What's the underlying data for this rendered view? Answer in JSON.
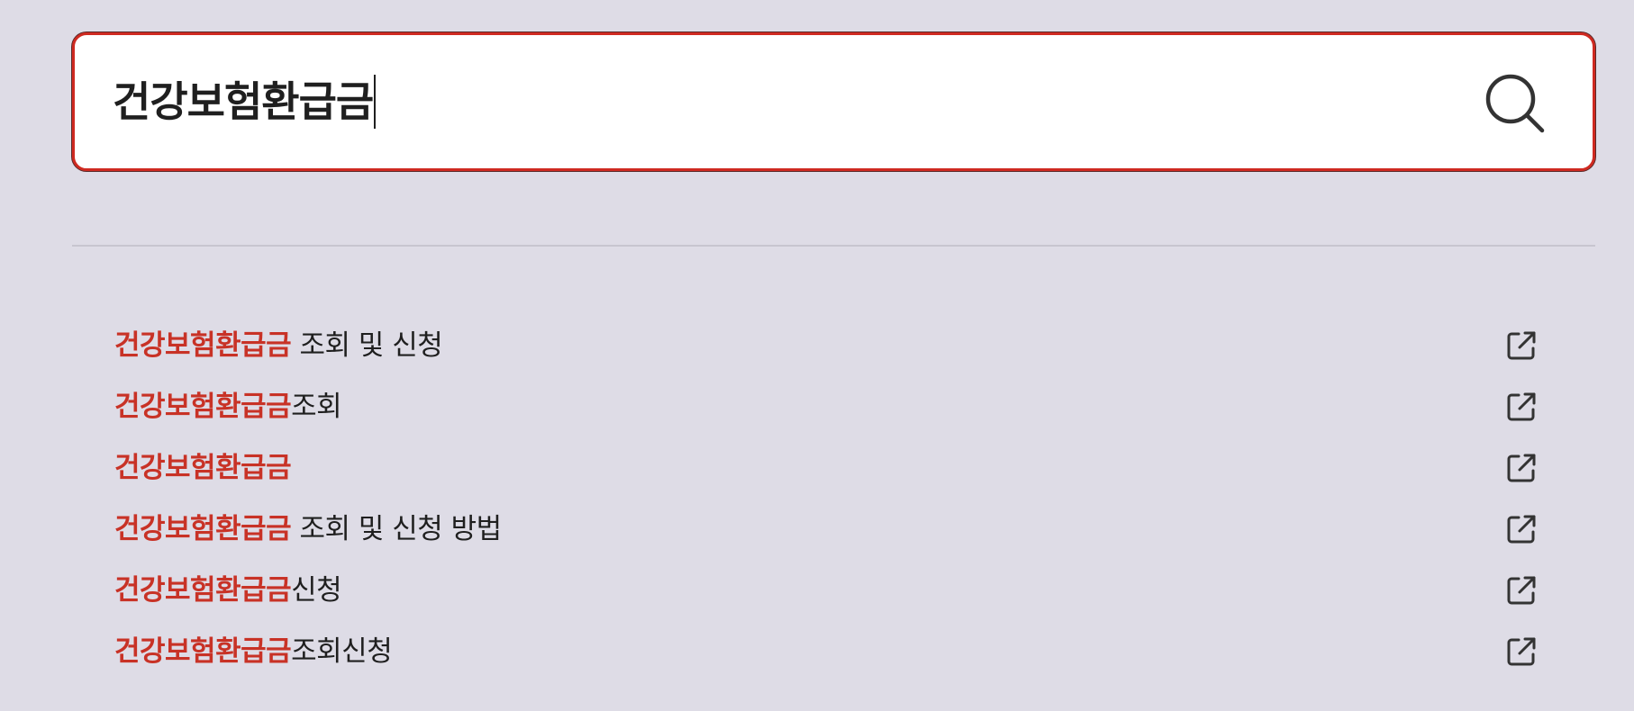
{
  "search": {
    "query": "건강보험환급금",
    "icon": "search-icon"
  },
  "suggestions": [
    {
      "highlight": "건강보험환급금",
      "rest": " 조회 및 신청",
      "icon": "external-link-icon"
    },
    {
      "highlight": "건강보험환급금",
      "rest": "조회",
      "icon": "external-link-icon"
    },
    {
      "highlight": "건강보험환급금",
      "rest": "",
      "icon": "external-link-icon"
    },
    {
      "highlight": "건강보험환급금",
      "rest": " 조회 및 신청 방법",
      "icon": "external-link-icon"
    },
    {
      "highlight": "건강보험환급금",
      "rest": "신청",
      "icon": "external-link-icon"
    },
    {
      "highlight": "건강보험환급금",
      "rest": "조회신청",
      "icon": "external-link-icon"
    }
  ],
  "colors": {
    "background": "#dedce6",
    "accent": "#cf2a21",
    "highlight_text": "#c83226",
    "text": "#1f1f1f"
  }
}
